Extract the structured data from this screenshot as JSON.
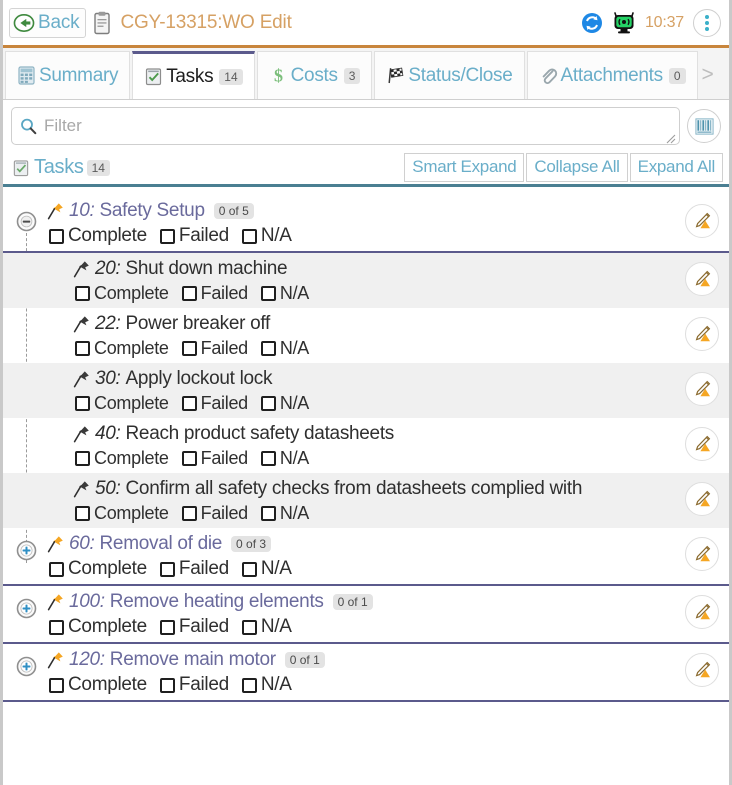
{
  "titlebar": {
    "back_label": "Back",
    "back_icon": "back-arrow-icon",
    "document_icon": "clipboard-icon",
    "title": "CGY-13315:WO Edit",
    "sync_icon": "sync-icon",
    "signal_icon": "connection-status-icon",
    "clock": "10:37",
    "menu_icon": "kebab-menu-icon"
  },
  "tabs": [
    {
      "label": "Summary",
      "icon": "summary-icon",
      "count": null,
      "active": false
    },
    {
      "label": "Tasks",
      "icon": "tasks-check-icon",
      "count": "14",
      "active": true
    },
    {
      "label": "Costs",
      "icon": "dollar-icon",
      "count": "3",
      "active": false
    },
    {
      "label": "Status/Close",
      "icon": "checkered-flag-icon",
      "count": null,
      "active": false
    },
    {
      "label": "Attachments",
      "icon": "paperclip-icon",
      "count": "0",
      "active": false
    }
  ],
  "tab_overflow_chevron": ">",
  "filter": {
    "placeholder": "Filter",
    "value": "",
    "search_icon": "search-icon",
    "grid_button_icon": "columns-grid-icon"
  },
  "section": {
    "icon": "tasks-check-icon",
    "title": "Tasks",
    "count": "14",
    "buttons": [
      {
        "label": "Smart Expand"
      },
      {
        "label": "Collapse All"
      },
      {
        "label": "Expand All"
      }
    ]
  },
  "checkbox_labels": {
    "complete": "Complete",
    "failed": "Failed",
    "na": "N/A"
  },
  "tasks": [
    {
      "id": "10",
      "number": "10:",
      "description": "Safety Setup",
      "badge": "0 of 5",
      "level": "parent",
      "expanded": true,
      "twisty": "collapse-icon",
      "pin": "pin-orange-icon",
      "edit_icon": "edit-pencil-icon"
    },
    {
      "id": "20",
      "number": "20:",
      "description": "Shut down machine",
      "badge": null,
      "level": "child",
      "shaded": true,
      "pin": "pin-dark-icon",
      "edit_icon": "edit-pencil-icon"
    },
    {
      "id": "22",
      "number": "22:",
      "description": "Power breaker off",
      "badge": null,
      "level": "child",
      "shaded": false,
      "pin": "pin-dark-icon",
      "edit_icon": "edit-pencil-icon"
    },
    {
      "id": "30",
      "number": "30:",
      "description": "Apply lockout lock",
      "badge": null,
      "level": "child",
      "shaded": true,
      "pin": "pin-dark-icon",
      "edit_icon": "edit-pencil-icon"
    },
    {
      "id": "40",
      "number": "40:",
      "description": "Reach product safety datasheets",
      "badge": null,
      "level": "child",
      "shaded": false,
      "pin": "pin-dark-icon",
      "edit_icon": "edit-pencil-icon"
    },
    {
      "id": "50",
      "number": "50:",
      "description": "Confirm all safety checks from datasheets complied with",
      "badge": null,
      "level": "child",
      "shaded": true,
      "pin": "pin-dark-icon",
      "edit_icon": "edit-pencil-icon"
    },
    {
      "id": "60",
      "number": "60:",
      "description": "Removal of die",
      "badge": "0 of 3",
      "level": "parent",
      "expanded": false,
      "twisty": "expand-icon",
      "pin": "pin-orange-icon",
      "edit_icon": "edit-pencil-icon"
    },
    {
      "id": "100",
      "number": "100:",
      "description": "Remove heating elements",
      "badge": "0 of 1",
      "level": "parent",
      "expanded": false,
      "twisty": "expand-icon",
      "pin": "pin-orange-icon",
      "edit_icon": "edit-pencil-icon"
    },
    {
      "id": "120",
      "number": "120:",
      "description": "Remove main motor",
      "badge": "0 of 1",
      "level": "parent",
      "expanded": false,
      "twisty": "expand-icon",
      "pin": "pin-orange-icon",
      "edit_icon": "edit-pencil-icon"
    }
  ],
  "colors": {
    "title_orange": "#d6a164",
    "link_blue": "#6aaec9",
    "accent_purple": "#5b5a8c",
    "section_underline": "#4a7f92",
    "pin_orange": "#f5a623",
    "row_shade": "#f0f0f0"
  }
}
